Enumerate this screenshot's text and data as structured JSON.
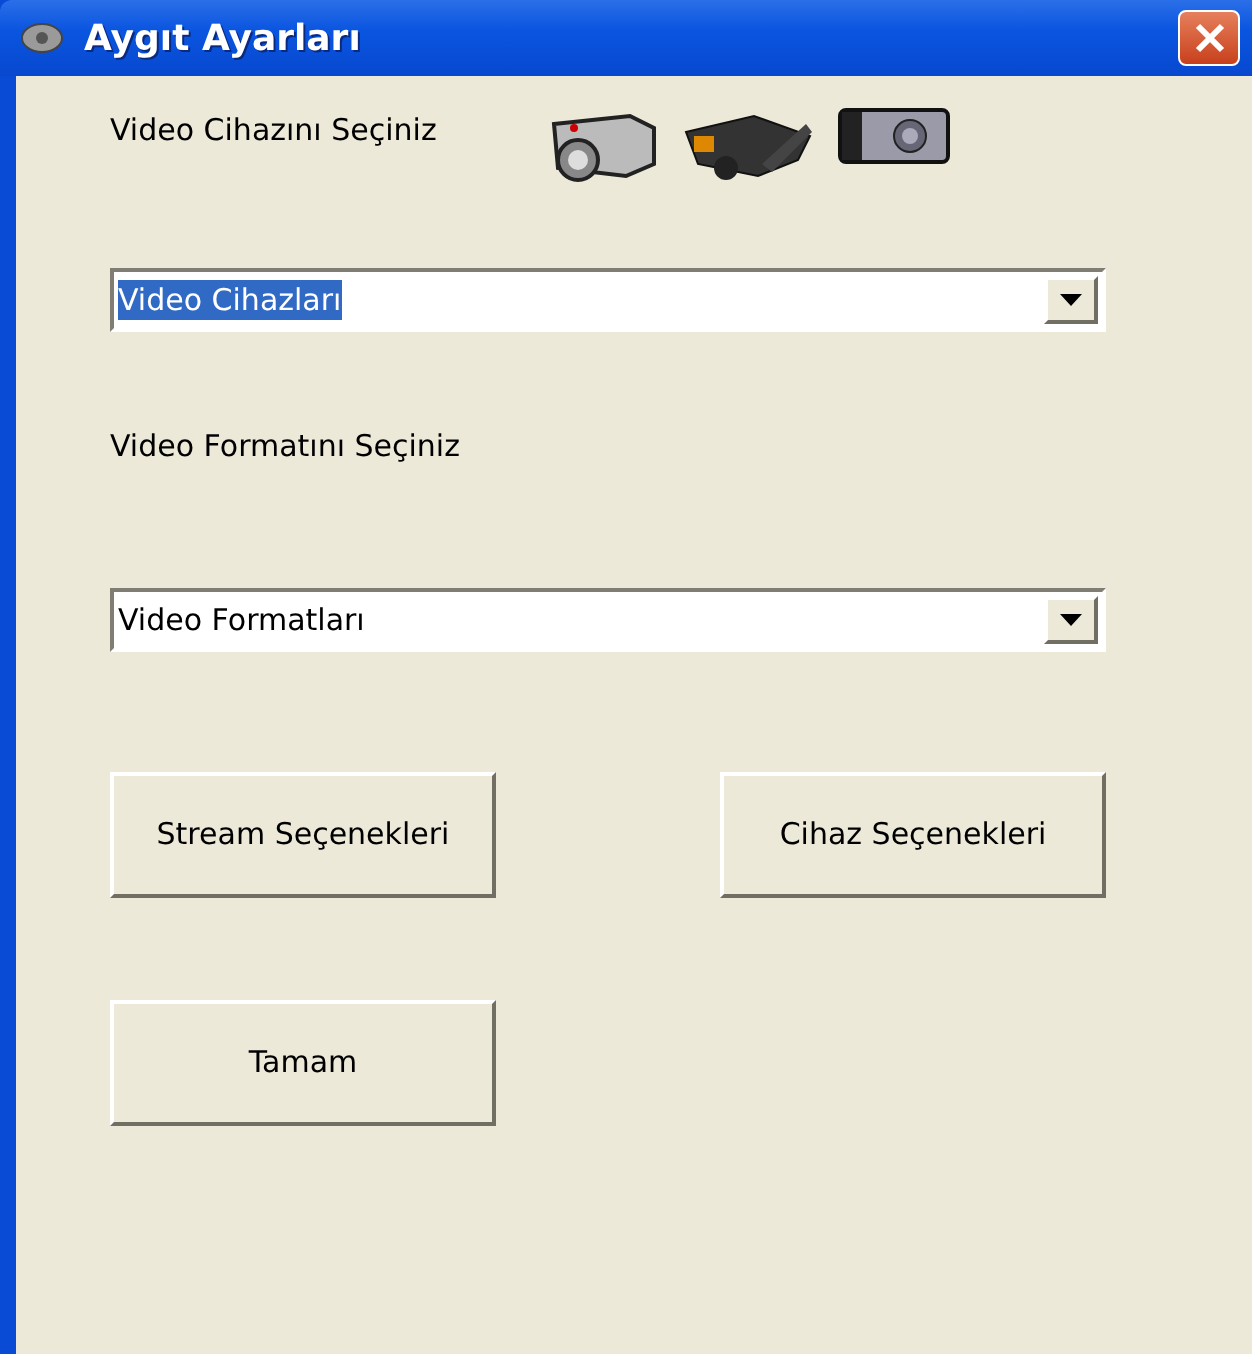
{
  "window": {
    "title": "Aygıt Ayarları"
  },
  "device_label": "Video Cihazını Seçiniz",
  "device_combo": {
    "value": "Video Cihazları",
    "text_selected": true
  },
  "format_label": "Video Formatını Seçiniz",
  "format_combo": {
    "value": "Video Formatları",
    "text_selected": false
  },
  "buttons": [
    {
      "label": "Stream Seçenekleri"
    },
    {
      "label": "Cihaz Seçenekleri"
    },
    {
      "label": "Tamam"
    }
  ]
}
